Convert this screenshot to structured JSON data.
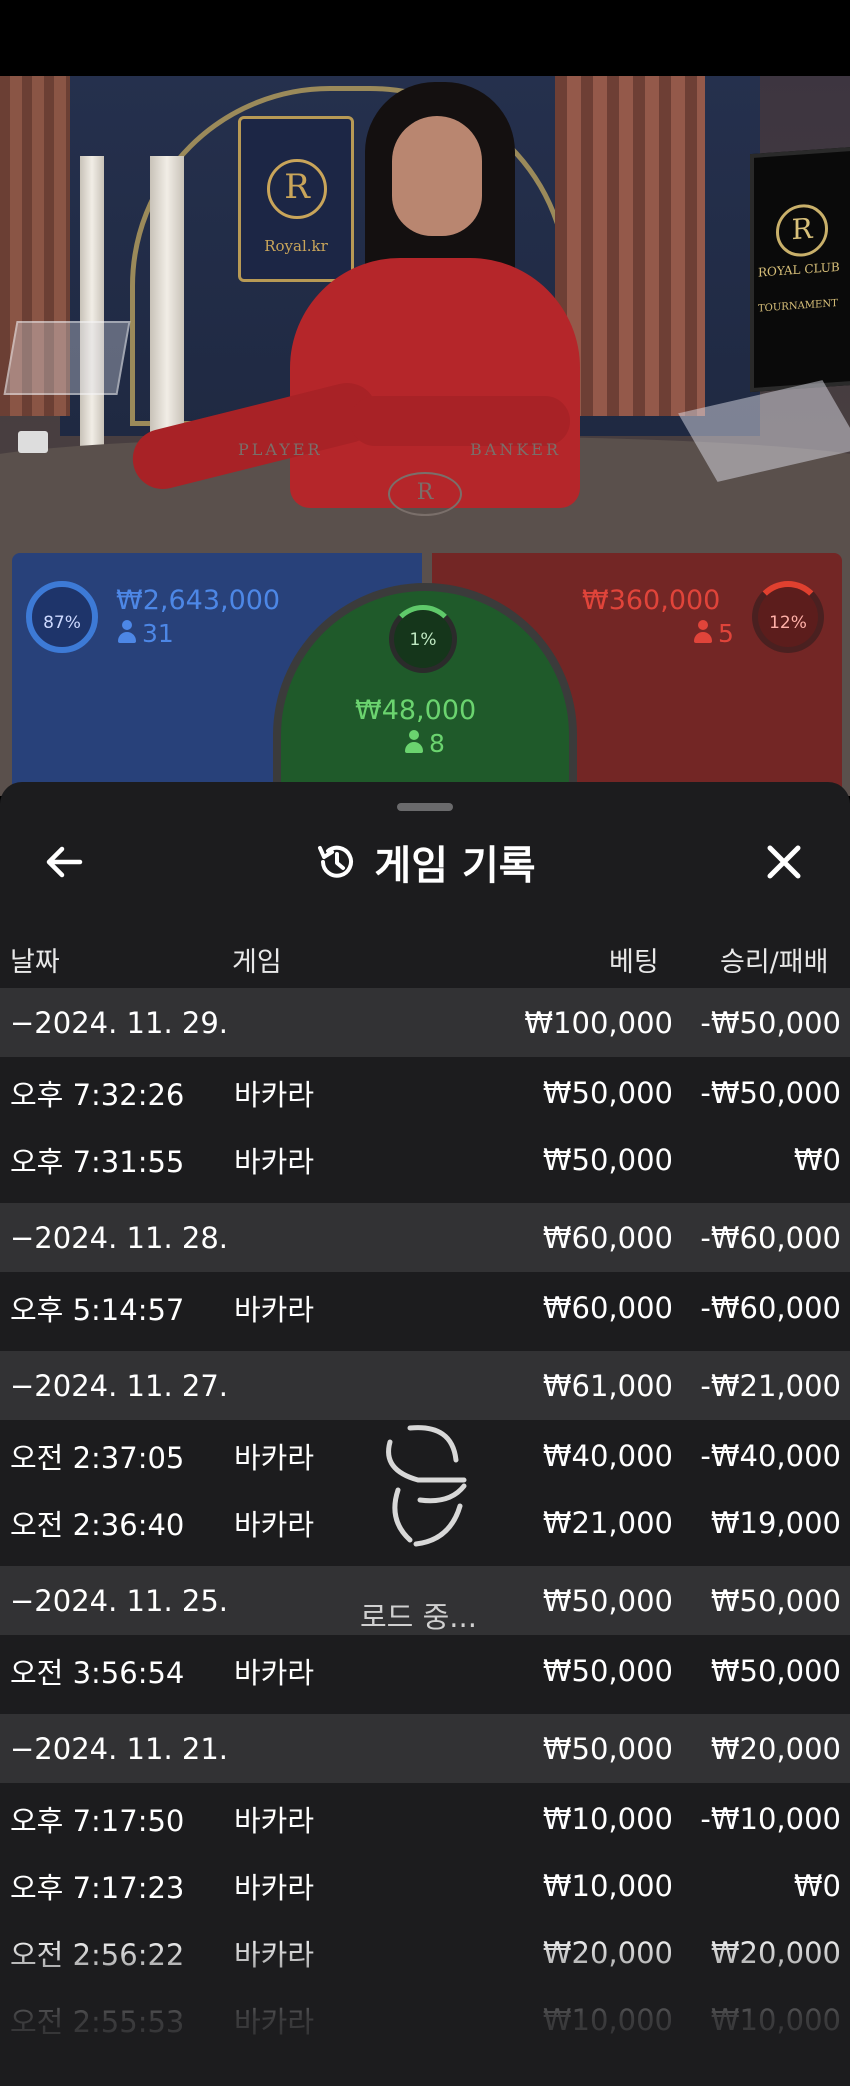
{
  "scene": {
    "table_brand": "Royal.kr",
    "monitor_line1": "ROYAL CLUB",
    "monitor_line2": "TOURNAMENT",
    "player_label": "PLAYER",
    "banker_label": "BANKER",
    "crest_letter": "R"
  },
  "bets": {
    "player": {
      "percent": "87%",
      "amount": "₩2,643,000",
      "count": "31",
      "color": "#4d87e6"
    },
    "tie": {
      "percent": "1%",
      "amount": "₩48,000",
      "count": "8",
      "color": "#6bd46f"
    },
    "banker": {
      "percent": "12%",
      "amount": "₩360,000",
      "count": "5",
      "color": "#e0443a"
    }
  },
  "history": {
    "title": "게임 기록",
    "icons": {
      "back": "arrow-left-icon",
      "title": "history-icon",
      "close": "close-icon",
      "loading": "loading-spinner-icon"
    },
    "columns": {
      "date": "날짜",
      "game": "게임",
      "bet": "베팅",
      "result": "승리/패배"
    },
    "groups": [
      {
        "date": "−2024. 11. 29.",
        "bet": "₩100,000",
        "result": "-₩50,000",
        "rows": [
          {
            "time": "오후 7:32:26",
            "game": "바카라",
            "bet": "₩50,000",
            "result": "-₩50,000"
          },
          {
            "time": "오후 7:31:55",
            "game": "바카라",
            "bet": "₩50,000",
            "result": "₩0"
          }
        ]
      },
      {
        "date": "−2024. 11. 28.",
        "bet": "₩60,000",
        "result": "-₩60,000",
        "rows": [
          {
            "time": "오후 5:14:57",
            "game": "바카라",
            "bet": "₩60,000",
            "result": "-₩60,000"
          }
        ]
      },
      {
        "date": "−2024. 11. 27.",
        "bet": "₩61,000",
        "result": "-₩21,000",
        "rows": [
          {
            "time": "오전 2:37:05",
            "game": "바카라",
            "bet": "₩40,000",
            "result": "-₩40,000"
          },
          {
            "time": "오전 2:36:40",
            "game": "바카라",
            "bet": "₩21,000",
            "result": "₩19,000"
          }
        ]
      },
      {
        "date": "−2024. 11. 25.",
        "bet": "₩50,000",
        "result": "₩50,000",
        "rows": [
          {
            "time": "오전 3:56:54",
            "game": "바카라",
            "bet": "₩50,000",
            "result": "₩50,000"
          }
        ]
      },
      {
        "date": "−2024. 11. 21.",
        "bet": "₩50,000",
        "result": "₩20,000",
        "rows": [
          {
            "time": "오후 7:17:50",
            "game": "바카라",
            "bet": "₩10,000",
            "result": "-₩10,000"
          },
          {
            "time": "오후 7:17:23",
            "game": "바카라",
            "bet": "₩10,000",
            "result": "₩0"
          },
          {
            "time": "오전 2:56:22",
            "game": "바카라",
            "bet": "₩20,000",
            "result": "₩20,000"
          },
          {
            "time": "오전 2:55:53",
            "game": "바카라",
            "bet": "₩10,000",
            "result": "₩10,000"
          }
        ]
      }
    ],
    "loading_text": "로드 중..."
  }
}
